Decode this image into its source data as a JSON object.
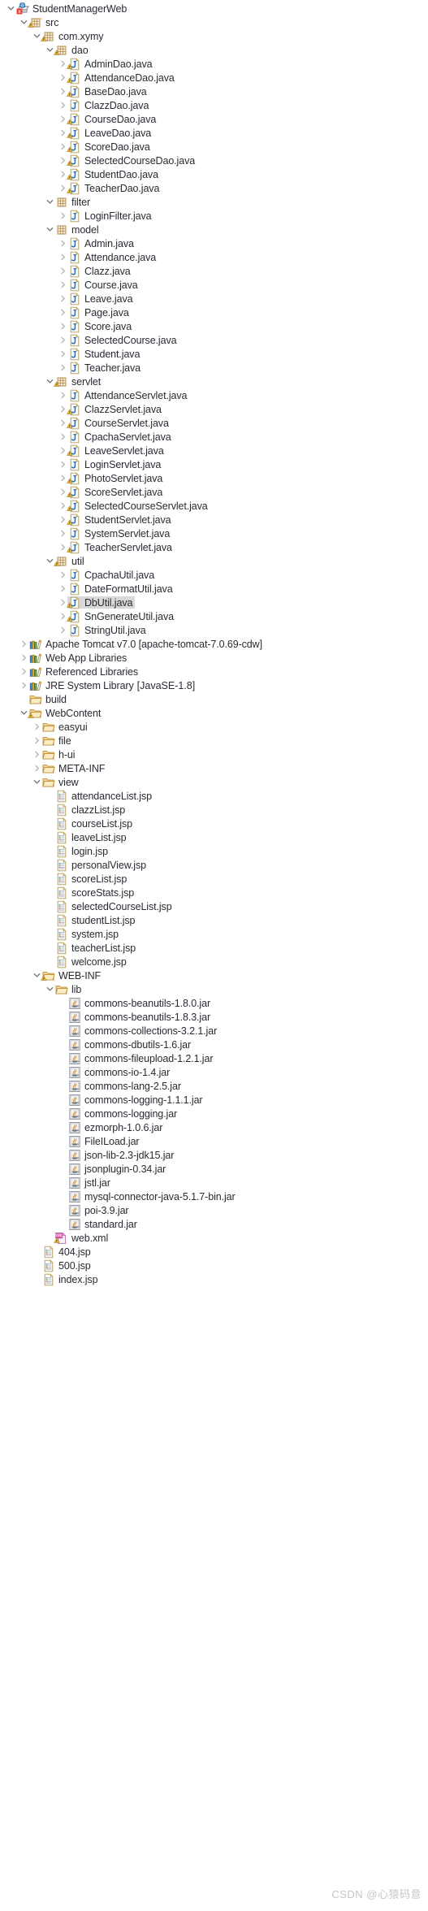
{
  "view": {
    "name": "Project Explorer",
    "watermark": "CSDN @心猿码意",
    "selection_color": "#d8d8d8",
    "text_color": "#2a2a33",
    "dim_text_color": "#9b9b9b"
  },
  "tree": [
    {
      "depth": 0,
      "label": "StudentManagerWeb",
      "icon": "java-web-project-icon",
      "state": "expanded",
      "selected": false
    },
    {
      "depth": 1,
      "label": "src",
      "icon": "source-folder-icon",
      "state": "expanded",
      "warning": true,
      "selected": false
    },
    {
      "depth": 2,
      "label": "com.xymy",
      "icon": "package-icon",
      "state": "expanded",
      "warning": true,
      "selected": false
    },
    {
      "depth": 3,
      "label": "dao",
      "icon": "package-icon",
      "state": "expanded",
      "warning": true,
      "selected": false
    },
    {
      "depth": 4,
      "label": "AdminDao.java",
      "icon": "java-file-icon",
      "state": "collapsed",
      "warning": true,
      "selected": false
    },
    {
      "depth": 4,
      "label": "AttendanceDao.java",
      "icon": "java-file-icon",
      "state": "collapsed",
      "warning": true,
      "selected": false
    },
    {
      "depth": 4,
      "label": "BaseDao.java",
      "icon": "java-file-icon",
      "state": "collapsed",
      "warning": true,
      "selected": false
    },
    {
      "depth": 4,
      "label": "ClazzDao.java",
      "icon": "java-file-icon",
      "state": "collapsed",
      "warning": false,
      "selected": false
    },
    {
      "depth": 4,
      "label": "CourseDao.java",
      "icon": "java-file-icon",
      "state": "collapsed",
      "warning": true,
      "selected": false
    },
    {
      "depth": 4,
      "label": "LeaveDao.java",
      "icon": "java-file-icon",
      "state": "collapsed",
      "warning": true,
      "selected": false
    },
    {
      "depth": 4,
      "label": "ScoreDao.java",
      "icon": "java-file-icon",
      "state": "collapsed",
      "warning": true,
      "selected": false
    },
    {
      "depth": 4,
      "label": "SelectedCourseDao.java",
      "icon": "java-file-icon",
      "state": "collapsed",
      "warning": true,
      "selected": false
    },
    {
      "depth": 4,
      "label": "StudentDao.java",
      "icon": "java-file-icon",
      "state": "collapsed",
      "warning": true,
      "selected": false
    },
    {
      "depth": 4,
      "label": "TeacherDao.java",
      "icon": "java-file-icon",
      "state": "collapsed",
      "warning": true,
      "selected": false
    },
    {
      "depth": 3,
      "label": "filter",
      "icon": "package-icon",
      "state": "expanded",
      "warning": false,
      "selected": false
    },
    {
      "depth": 4,
      "label": "LoginFilter.java",
      "icon": "java-file-icon",
      "state": "collapsed",
      "warning": false,
      "selected": false
    },
    {
      "depth": 3,
      "label": "model",
      "icon": "package-icon",
      "state": "expanded",
      "warning": false,
      "selected": false
    },
    {
      "depth": 4,
      "label": "Admin.java",
      "icon": "java-file-icon",
      "state": "collapsed",
      "warning": false,
      "selected": false
    },
    {
      "depth": 4,
      "label": "Attendance.java",
      "icon": "java-file-icon",
      "state": "collapsed",
      "warning": false,
      "selected": false
    },
    {
      "depth": 4,
      "label": "Clazz.java",
      "icon": "java-file-icon",
      "state": "collapsed",
      "warning": false,
      "selected": false
    },
    {
      "depth": 4,
      "label": "Course.java",
      "icon": "java-file-icon",
      "state": "collapsed",
      "warning": false,
      "selected": false
    },
    {
      "depth": 4,
      "label": "Leave.java",
      "icon": "java-file-icon",
      "state": "collapsed",
      "warning": false,
      "selected": false
    },
    {
      "depth": 4,
      "label": "Page.java",
      "icon": "java-file-icon",
      "state": "collapsed",
      "warning": false,
      "selected": false
    },
    {
      "depth": 4,
      "label": "Score.java",
      "icon": "java-file-icon",
      "state": "collapsed",
      "warning": false,
      "selected": false
    },
    {
      "depth": 4,
      "label": "SelectedCourse.java",
      "icon": "java-file-icon",
      "state": "collapsed",
      "warning": false,
      "selected": false
    },
    {
      "depth": 4,
      "label": "Student.java",
      "icon": "java-file-icon",
      "state": "collapsed",
      "warning": false,
      "selected": false
    },
    {
      "depth": 4,
      "label": "Teacher.java",
      "icon": "java-file-icon",
      "state": "collapsed",
      "warning": false,
      "selected": false
    },
    {
      "depth": 3,
      "label": "servlet",
      "icon": "package-icon",
      "state": "expanded",
      "warning": true,
      "selected": false
    },
    {
      "depth": 4,
      "label": "AttendanceServlet.java",
      "icon": "java-file-icon",
      "state": "collapsed",
      "warning": false,
      "selected": false
    },
    {
      "depth": 4,
      "label": "ClazzServlet.java",
      "icon": "java-file-icon",
      "state": "collapsed",
      "warning": true,
      "selected": false
    },
    {
      "depth": 4,
      "label": "CourseServlet.java",
      "icon": "java-file-icon",
      "state": "collapsed",
      "warning": true,
      "selected": false
    },
    {
      "depth": 4,
      "label": "CpachaServlet.java",
      "icon": "java-file-icon",
      "state": "collapsed",
      "warning": false,
      "selected": false
    },
    {
      "depth": 4,
      "label": "LeaveServlet.java",
      "icon": "java-file-icon",
      "state": "collapsed",
      "warning": true,
      "selected": false
    },
    {
      "depth": 4,
      "label": "LoginServlet.java",
      "icon": "java-file-icon",
      "state": "collapsed",
      "warning": false,
      "selected": false
    },
    {
      "depth": 4,
      "label": "PhotoServlet.java",
      "icon": "java-file-icon",
      "state": "collapsed",
      "warning": true,
      "selected": false
    },
    {
      "depth": 4,
      "label": "ScoreServlet.java",
      "icon": "java-file-icon",
      "state": "collapsed",
      "warning": true,
      "selected": false
    },
    {
      "depth": 4,
      "label": "SelectedCourseServlet.java",
      "icon": "java-file-icon",
      "state": "collapsed",
      "warning": true,
      "selected": false
    },
    {
      "depth": 4,
      "label": "StudentServlet.java",
      "icon": "java-file-icon",
      "state": "collapsed",
      "warning": true,
      "selected": false
    },
    {
      "depth": 4,
      "label": "SystemServlet.java",
      "icon": "java-file-icon",
      "state": "collapsed",
      "warning": false,
      "selected": false
    },
    {
      "depth": 4,
      "label": "TeacherServlet.java",
      "icon": "java-file-icon",
      "state": "collapsed",
      "warning": true,
      "selected": false
    },
    {
      "depth": 3,
      "label": "util",
      "icon": "package-icon",
      "state": "expanded",
      "warning": true,
      "selected": false
    },
    {
      "depth": 4,
      "label": "CpachaUtil.java",
      "icon": "java-file-icon",
      "state": "collapsed",
      "warning": false,
      "selected": false
    },
    {
      "depth": 4,
      "label": "DateFormatUtil.java",
      "icon": "java-file-icon",
      "state": "collapsed",
      "warning": false,
      "selected": false
    },
    {
      "depth": 4,
      "label": "DbUtil.java",
      "icon": "java-file-icon",
      "state": "collapsed",
      "warning": true,
      "selected": true
    },
    {
      "depth": 4,
      "label": "SnGenerateUtil.java",
      "icon": "java-file-icon",
      "state": "collapsed",
      "warning": true,
      "selected": false
    },
    {
      "depth": 4,
      "label": "StringUtil.java",
      "icon": "java-file-icon",
      "state": "collapsed",
      "warning": false,
      "selected": false
    },
    {
      "depth": 1,
      "label": "Apache Tomcat v7.0 [apache-tomcat-7.0.69-cdw]",
      "icon": "library-icon",
      "state": "collapsed",
      "selected": false
    },
    {
      "depth": 1,
      "label": "Web App Libraries",
      "icon": "library-icon",
      "state": "collapsed",
      "selected": false
    },
    {
      "depth": 1,
      "label": "Referenced Libraries",
      "icon": "library-icon",
      "state": "collapsed",
      "selected": false
    },
    {
      "depth": 1,
      "label": "JRE System Library",
      "suffix": "[JavaSE-1.8]",
      "icon": "library-icon",
      "state": "collapsed",
      "selected": false
    },
    {
      "depth": 1,
      "label": "build",
      "icon": "folder-icon",
      "state": "none",
      "selected": false
    },
    {
      "depth": 1,
      "label": "WebContent",
      "icon": "folder-icon",
      "state": "expanded",
      "warning": true,
      "selected": false
    },
    {
      "depth": 2,
      "label": "easyui",
      "icon": "folder-icon",
      "state": "collapsed",
      "selected": false
    },
    {
      "depth": 2,
      "label": "file",
      "icon": "folder-icon",
      "state": "collapsed",
      "selected": false
    },
    {
      "depth": 2,
      "label": "h-ui",
      "icon": "folder-icon",
      "state": "collapsed",
      "selected": false
    },
    {
      "depth": 2,
      "label": "META-INF",
      "icon": "folder-icon",
      "state": "collapsed",
      "selected": false
    },
    {
      "depth": 2,
      "label": "view",
      "icon": "folder-icon",
      "state": "expanded",
      "selected": false
    },
    {
      "depth": 3,
      "label": "attendanceList.jsp",
      "icon": "jsp-file-icon",
      "state": "none",
      "selected": false
    },
    {
      "depth": 3,
      "label": "clazzList.jsp",
      "icon": "jsp-file-icon",
      "state": "none",
      "selected": false
    },
    {
      "depth": 3,
      "label": "courseList.jsp",
      "icon": "jsp-file-icon",
      "state": "none",
      "selected": false
    },
    {
      "depth": 3,
      "label": "leaveList.jsp",
      "icon": "jsp-file-icon",
      "state": "none",
      "selected": false
    },
    {
      "depth": 3,
      "label": "login.jsp",
      "icon": "jsp-file-icon",
      "state": "none",
      "selected": false
    },
    {
      "depth": 3,
      "label": "personalView.jsp",
      "icon": "jsp-file-icon",
      "state": "none",
      "selected": false
    },
    {
      "depth": 3,
      "label": "scoreList.jsp",
      "icon": "jsp-file-icon",
      "state": "none",
      "selected": false
    },
    {
      "depth": 3,
      "label": "scoreStats.jsp",
      "icon": "jsp-file-icon",
      "state": "none",
      "selected": false
    },
    {
      "depth": 3,
      "label": "selectedCourseList.jsp",
      "icon": "jsp-file-icon",
      "state": "none",
      "selected": false
    },
    {
      "depth": 3,
      "label": "studentList.jsp",
      "icon": "jsp-file-icon",
      "state": "none",
      "selected": false
    },
    {
      "depth": 3,
      "label": "system.jsp",
      "icon": "jsp-file-icon",
      "state": "none",
      "selected": false
    },
    {
      "depth": 3,
      "label": "teacherList.jsp",
      "icon": "jsp-file-icon",
      "state": "none",
      "selected": false
    },
    {
      "depth": 3,
      "label": "welcome.jsp",
      "icon": "jsp-file-icon",
      "state": "none",
      "selected": false
    },
    {
      "depth": 2,
      "label": "WEB-INF",
      "icon": "folder-icon",
      "state": "expanded",
      "warning": true,
      "selected": false
    },
    {
      "depth": 3,
      "label": "lib",
      "icon": "folder-icon",
      "state": "expanded",
      "selected": false
    },
    {
      "depth": 4,
      "label": "commons-beanutils-1.8.0.jar",
      "icon": "jar-file-icon",
      "state": "none",
      "selected": false
    },
    {
      "depth": 4,
      "label": "commons-beanutils-1.8.3.jar",
      "icon": "jar-file-icon",
      "state": "none",
      "selected": false
    },
    {
      "depth": 4,
      "label": "commons-collections-3.2.1.jar",
      "icon": "jar-file-icon",
      "state": "none",
      "selected": false
    },
    {
      "depth": 4,
      "label": "commons-dbutils-1.6.jar",
      "icon": "jar-file-icon",
      "state": "none",
      "selected": false
    },
    {
      "depth": 4,
      "label": "commons-fileupload-1.2.1.jar",
      "icon": "jar-file-icon",
      "state": "none",
      "selected": false
    },
    {
      "depth": 4,
      "label": "commons-io-1.4.jar",
      "icon": "jar-file-icon",
      "state": "none",
      "selected": false
    },
    {
      "depth": 4,
      "label": "commons-lang-2.5.jar",
      "icon": "jar-file-icon",
      "state": "none",
      "selected": false
    },
    {
      "depth": 4,
      "label": "commons-logging-1.1.1.jar",
      "icon": "jar-file-icon",
      "state": "none",
      "selected": false
    },
    {
      "depth": 4,
      "label": "commons-logging.jar",
      "icon": "jar-file-icon",
      "state": "none",
      "selected": false
    },
    {
      "depth": 4,
      "label": "ezmorph-1.0.6.jar",
      "icon": "jar-file-icon",
      "state": "none",
      "selected": false
    },
    {
      "depth": 4,
      "label": "FileILoad.jar",
      "icon": "jar-file-icon",
      "state": "none",
      "selected": false
    },
    {
      "depth": 4,
      "label": "json-lib-2.3-jdk15.jar",
      "icon": "jar-file-icon",
      "state": "none",
      "selected": false
    },
    {
      "depth": 4,
      "label": "jsonplugin-0.34.jar",
      "icon": "jar-file-icon",
      "state": "none",
      "selected": false
    },
    {
      "depth": 4,
      "label": "jstl.jar",
      "icon": "jar-file-icon",
      "state": "none",
      "selected": false
    },
    {
      "depth": 4,
      "label": "mysql-connector-java-5.1.7-bin.jar",
      "icon": "jar-file-icon",
      "state": "none",
      "selected": false
    },
    {
      "depth": 4,
      "label": "poi-3.9.jar",
      "icon": "jar-file-icon",
      "state": "none",
      "selected": false
    },
    {
      "depth": 4,
      "label": "standard.jar",
      "icon": "jar-file-icon",
      "state": "none",
      "selected": false
    },
    {
      "depth": 3,
      "label": "web.xml",
      "icon": "xml-file-icon",
      "state": "none",
      "warning": true,
      "selected": false
    },
    {
      "depth": 2,
      "label": "404.jsp",
      "icon": "jsp-file-icon",
      "state": "none",
      "selected": false
    },
    {
      "depth": 2,
      "label": "500.jsp",
      "icon": "jsp-file-icon",
      "state": "none",
      "selected": false
    },
    {
      "depth": 2,
      "label": "index.jsp",
      "icon": "jsp-file-icon",
      "state": "none",
      "selected": false
    }
  ]
}
